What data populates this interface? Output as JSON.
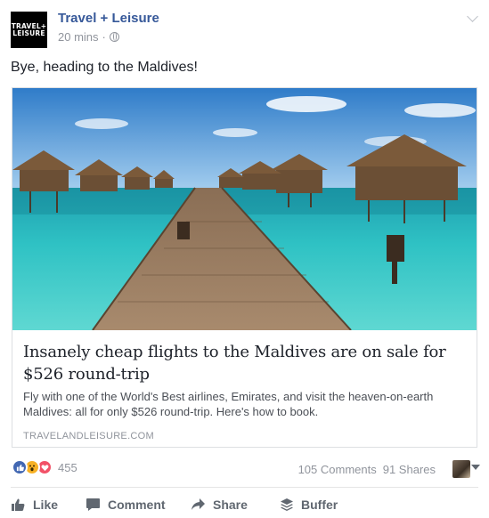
{
  "header": {
    "avatar_line1": "TRAVEL+",
    "avatar_line2": "LEISURE",
    "page_name": "Travel + Leisure",
    "timestamp": "20 mins",
    "separator": "·"
  },
  "post": {
    "status_text": "Bye, heading to the Maldives!"
  },
  "link_card": {
    "title": "Insanely cheap flights to the Maldives are on sale for $526 round-trip",
    "description": "Fly with one of the World's Best airlines, Emirates, and visit the heaven-on-earth Maldives: all for only $526 round-trip. Here's how to book.",
    "domain": "TRAVELANDLEISURE.COM"
  },
  "engagement": {
    "reaction_count": "455",
    "comments": "105 Comments",
    "shares": "91 Shares"
  },
  "actions": {
    "like": "Like",
    "comment": "Comment",
    "share": "Share",
    "buffer": "Buffer"
  },
  "colors": {
    "link_blue": "#365899",
    "meta_gray": "#90949c",
    "like_blue": "#4267b2",
    "love_red": "#f25268",
    "wow_yellow": "#f7b125"
  }
}
